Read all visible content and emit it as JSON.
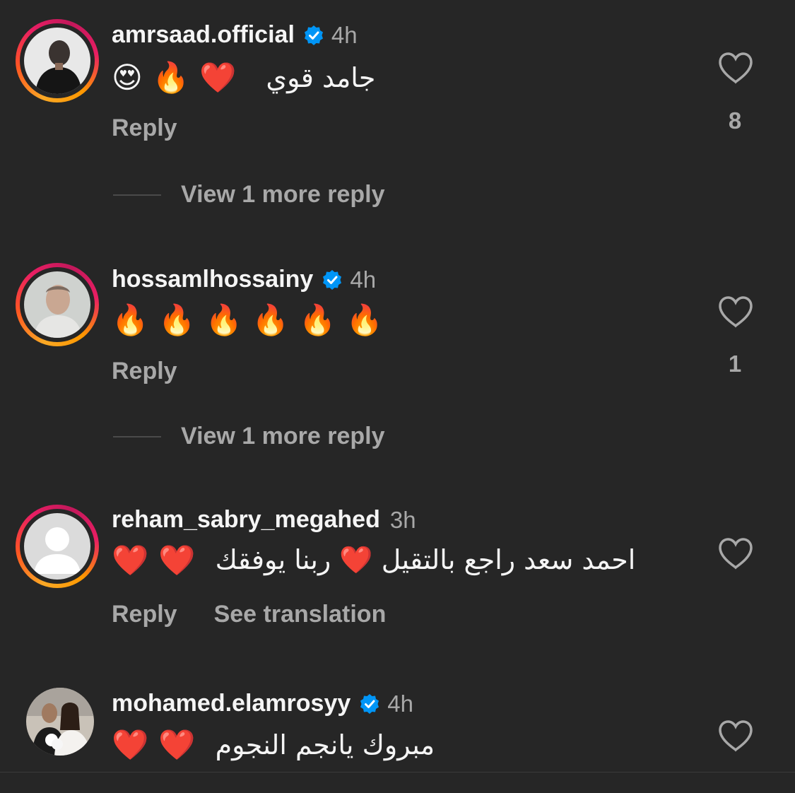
{
  "comments": [
    {
      "username": "amrsaad.official",
      "verified": true,
      "time": "4h",
      "text": "جامد قوي",
      "emojis": [
        "❤️",
        "🔥",
        "😍"
      ],
      "reply_label": "Reply",
      "likes": "8",
      "view_more": "View 1 more reply"
    },
    {
      "username": "hossamlhossainy",
      "verified": true,
      "time": "4h",
      "emojis": [
        "🔥",
        "🔥",
        "🔥",
        "🔥",
        "🔥",
        "🔥"
      ],
      "reply_label": "Reply",
      "likes": "1",
      "view_more": "View 1 more reply"
    },
    {
      "username": "reham_sabry_megahed",
      "verified": false,
      "time": "3h",
      "text": "احمد سعد راجع بالتقيل ❤️ ربنا يوفقك",
      "emojis": [
        "❤️",
        "❤️"
      ],
      "reply_label": "Reply",
      "translate_label": "See translation"
    },
    {
      "username": "mohamed.elamrosyy",
      "verified": true,
      "time": "4h",
      "text": "مبروك يانجم النجوم",
      "emojis": [
        "❤️",
        "❤️"
      ]
    }
  ],
  "colors": {
    "background": "#262626",
    "primary_text": "#f5f5f5",
    "secondary_text": "#a8a8a8",
    "verified_blue": "#0095f6"
  },
  "icons": {
    "like": "heart-outline-icon",
    "verified": "verified-badge-icon"
  }
}
